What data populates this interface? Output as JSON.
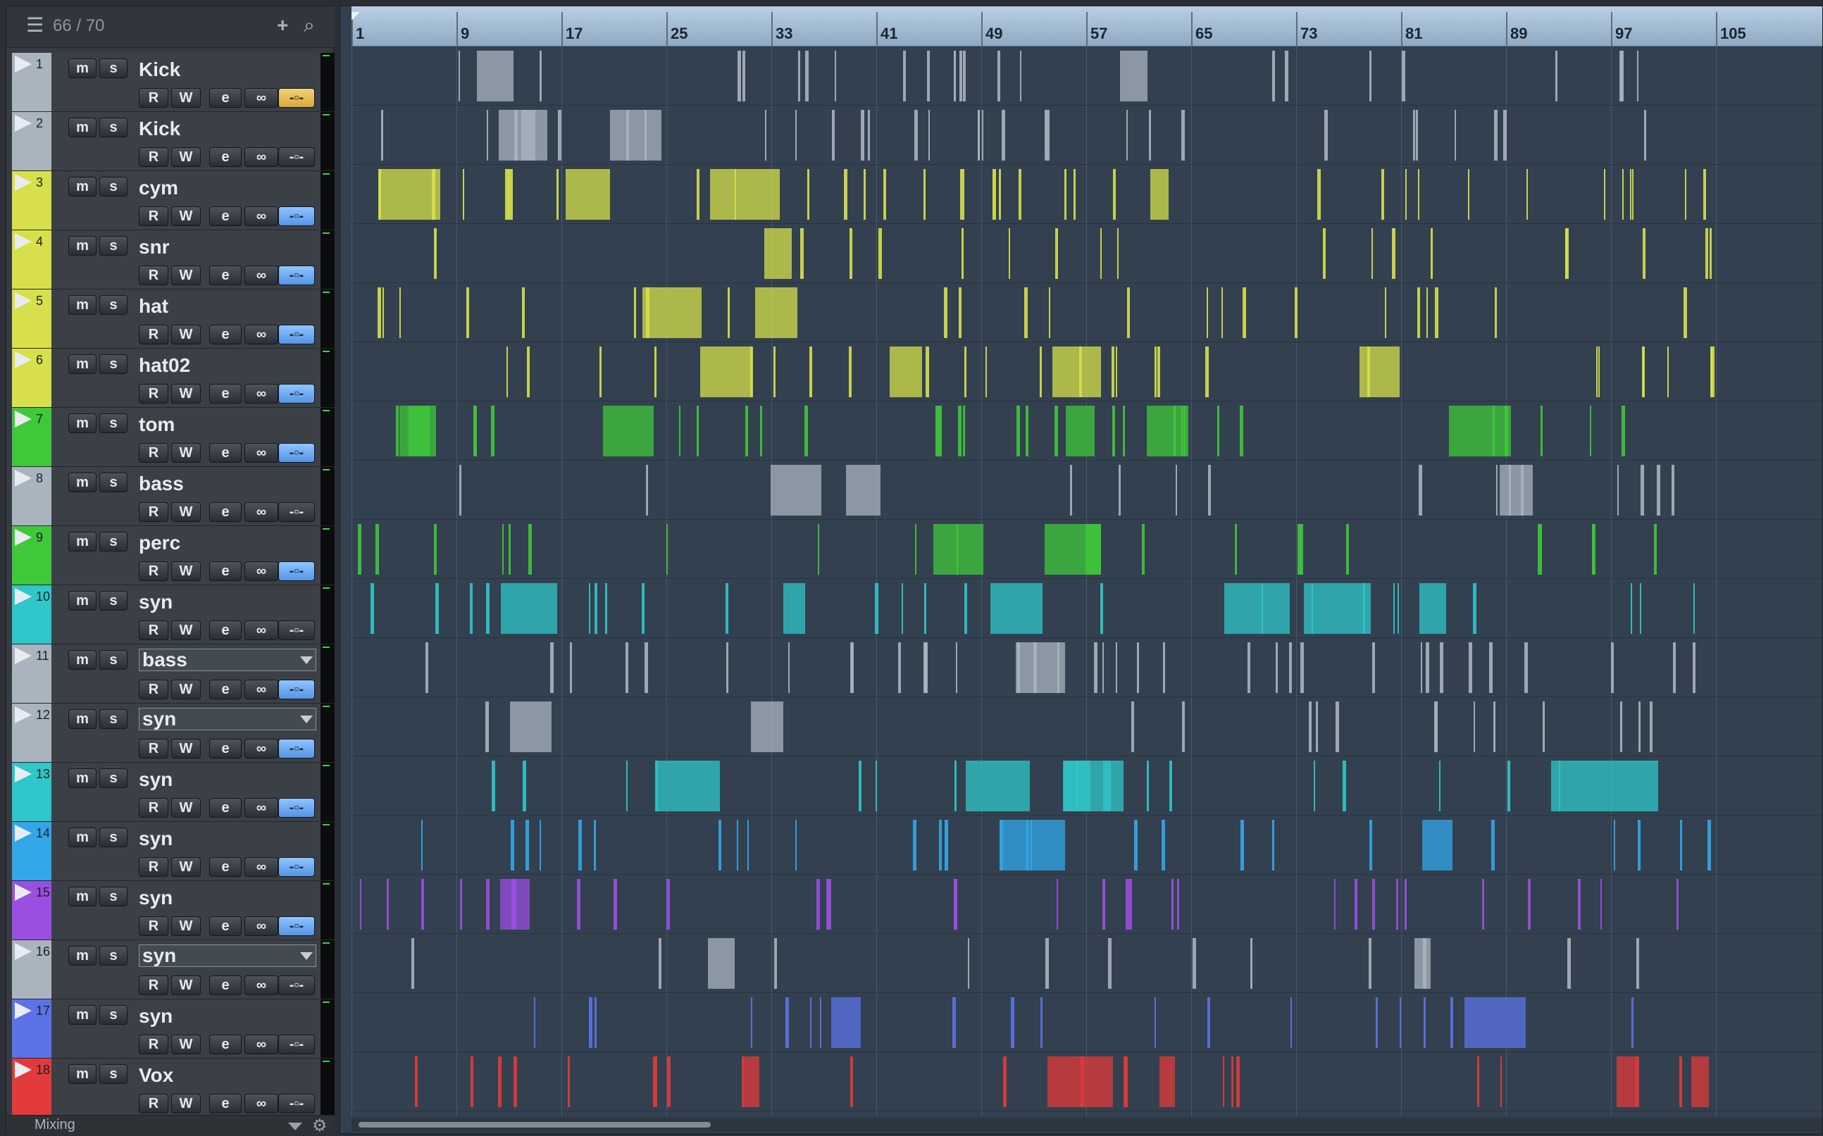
{
  "header": {
    "track_count": "66 / 70",
    "list_icon": "list-icon",
    "add_icon": "plus-icon",
    "search_icon": "search-icon"
  },
  "buttons": {
    "mute": "m",
    "solo": "s",
    "read": "R",
    "write": "W",
    "edit": "e",
    "link": "∞",
    "monitor": "-▫-"
  },
  "tracks": [
    {
      "num": "1",
      "name": "Kick",
      "color": "#a9b4bf",
      "mon": "rec",
      "type": "label"
    },
    {
      "num": "2",
      "name": "Kick",
      "color": "#a9b4bf",
      "mon": "off",
      "type": "label"
    },
    {
      "num": "3",
      "name": "cym",
      "color": "#d7e04a",
      "mon": "on",
      "type": "label"
    },
    {
      "num": "4",
      "name": "snr",
      "color": "#d7e04a",
      "mon": "on",
      "type": "label"
    },
    {
      "num": "5",
      "name": "hat",
      "color": "#d7e04a",
      "mon": "on",
      "type": "label"
    },
    {
      "num": "6",
      "name": "hat02",
      "color": "#d7e04a",
      "mon": "on",
      "type": "label"
    },
    {
      "num": "7",
      "name": "tom",
      "color": "#3fc83a",
      "mon": "on",
      "type": "label"
    },
    {
      "num": "8",
      "name": "bass",
      "color": "#a9b4bf",
      "mon": "off",
      "type": "label"
    },
    {
      "num": "9",
      "name": "perc",
      "color": "#3fc83a",
      "mon": "on",
      "type": "label"
    },
    {
      "num": "10",
      "name": "syn",
      "color": "#2fc7c9",
      "mon": "off",
      "type": "label"
    },
    {
      "num": "11",
      "name": "bass",
      "color": "#a9b4bf",
      "mon": "on",
      "type": "drop"
    },
    {
      "num": "12",
      "name": "syn",
      "color": "#a9b4bf",
      "mon": "on",
      "type": "drop"
    },
    {
      "num": "13",
      "name": "syn",
      "color": "#2fc7c9",
      "mon": "on",
      "type": "label"
    },
    {
      "num": "14",
      "name": "syn",
      "color": "#32a7e8",
      "mon": "on",
      "type": "label"
    },
    {
      "num": "15",
      "name": "syn",
      "color": "#9a4fe0",
      "mon": "on",
      "type": "label"
    },
    {
      "num": "16",
      "name": "syn",
      "color": "#a9b4bf",
      "mon": "off",
      "type": "drop"
    },
    {
      "num": "17",
      "name": "syn",
      "color": "#5b73e6",
      "mon": "off",
      "type": "label"
    },
    {
      "num": "18",
      "name": "Vox",
      "color": "#e23a3a",
      "mon": "off",
      "type": "label"
    }
  ],
  "ruler": {
    "bars": [
      "1",
      "9",
      "17",
      "25",
      "33",
      "41",
      "49",
      "57",
      "65",
      "73",
      "81",
      "89",
      "97",
      "105"
    ]
  },
  "footer": {
    "label": "Mixing",
    "gear_icon": "gear-icon"
  },
  "colors": {
    "lane_bg": "#33404f",
    "ruler": "#a9c1d8"
  }
}
